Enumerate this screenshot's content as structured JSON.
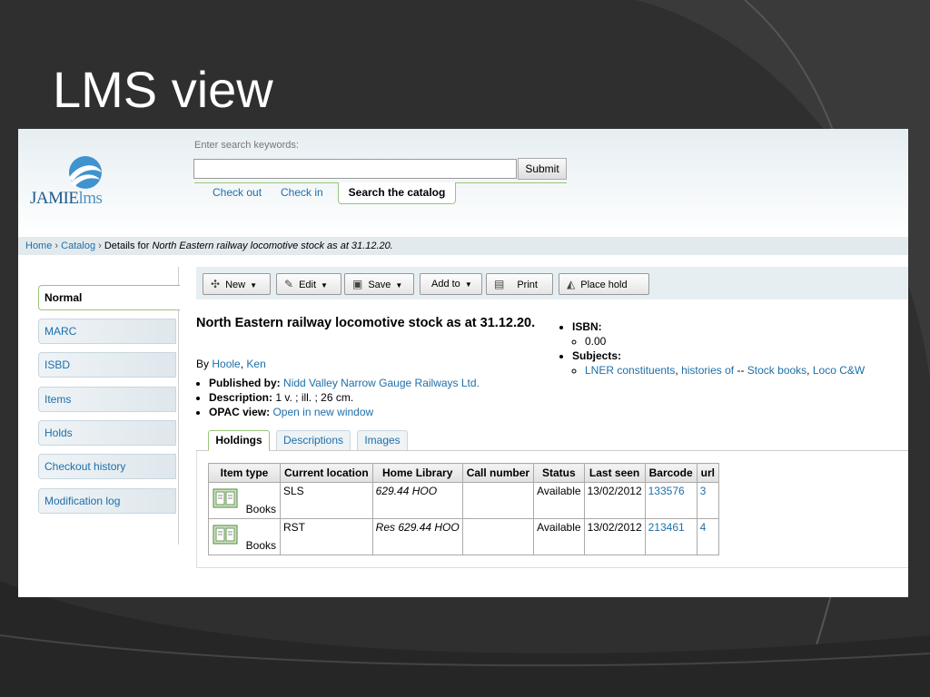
{
  "slide": {
    "title": "LMS view"
  },
  "header": {
    "logo": {
      "name": "JAMIE",
      "suffix": "lms"
    },
    "search_label": "Enter search keywords:",
    "search_value": "",
    "submit_label": "Submit",
    "tabs": [
      "Check out",
      "Check in",
      "Search the catalog"
    ]
  },
  "breadcrumb": {
    "home": "Home",
    "catalog": "Catalog",
    "details_prefix": "Details for",
    "record_title": "North Eastern railway locomotive stock as at 31.12.20.",
    "separator": "›"
  },
  "sidebar": {
    "items": [
      "Normal",
      "MARC",
      "ISBD",
      "Items",
      "Holds",
      "Checkout history",
      "Modification log"
    ]
  },
  "toolbar": {
    "new_label": "New",
    "edit_label": "Edit",
    "save_label": "Save",
    "addto_label": "Add to",
    "print_label": "Print",
    "placehold_label": "Place hold"
  },
  "record": {
    "title": "North Eastern railway locomotive stock as at 31.12.20.",
    "by_label": "By",
    "author_first": "Hoole",
    "author_sep": ",",
    "author_last": "Ken",
    "published_label": "Published by:",
    "publisher": "Nidd Valley Narrow Gauge Railways Ltd.",
    "description_label": "Description:",
    "description": "1 v. ; ill. ; 26 cm.",
    "opac_label": "OPAC view:",
    "opac_link": "Open in new window",
    "isbn_label": "ISBN:",
    "isbn_value": "0.00",
    "subjects_label": "Subjects:",
    "subject_1": "LNER constituents",
    "subject_sep": ",",
    "subject_2": "histories of",
    "subject_dash": "--",
    "subject_3": "Stock books",
    "subject_4": "Loco C&W"
  },
  "detail_tabs": [
    "Holdings",
    "Descriptions",
    "Images"
  ],
  "holdings": {
    "columns": [
      "Item type",
      "Current location",
      "Home Library",
      "Call number",
      "Status",
      "Last seen",
      "Barcode",
      "url"
    ],
    "rows": [
      {
        "item_type": "Books",
        "location": "SLS",
        "call_number": "629.44 HOO",
        "call_extra": "",
        "status": "Available",
        "last_seen": "13/02/2012",
        "barcode": "133576",
        "url": "3"
      },
      {
        "item_type": "Books",
        "location": "RST",
        "call_number": "Res 629.44 HOO",
        "call_extra": "",
        "status": "Available",
        "last_seen": "13/02/2012",
        "barcode": "213461",
        "url": "4"
      }
    ]
  },
  "colors": {
    "accent": "#1d6fa8",
    "tab_border": "#9ac57a",
    "slide_bg": "#2f2f2f"
  },
  "icons": [
    "plus-icon",
    "edit-icon",
    "save-icon",
    "print-icon",
    "place-hold-icon",
    "book-icon",
    "chevron-down-icon"
  ]
}
